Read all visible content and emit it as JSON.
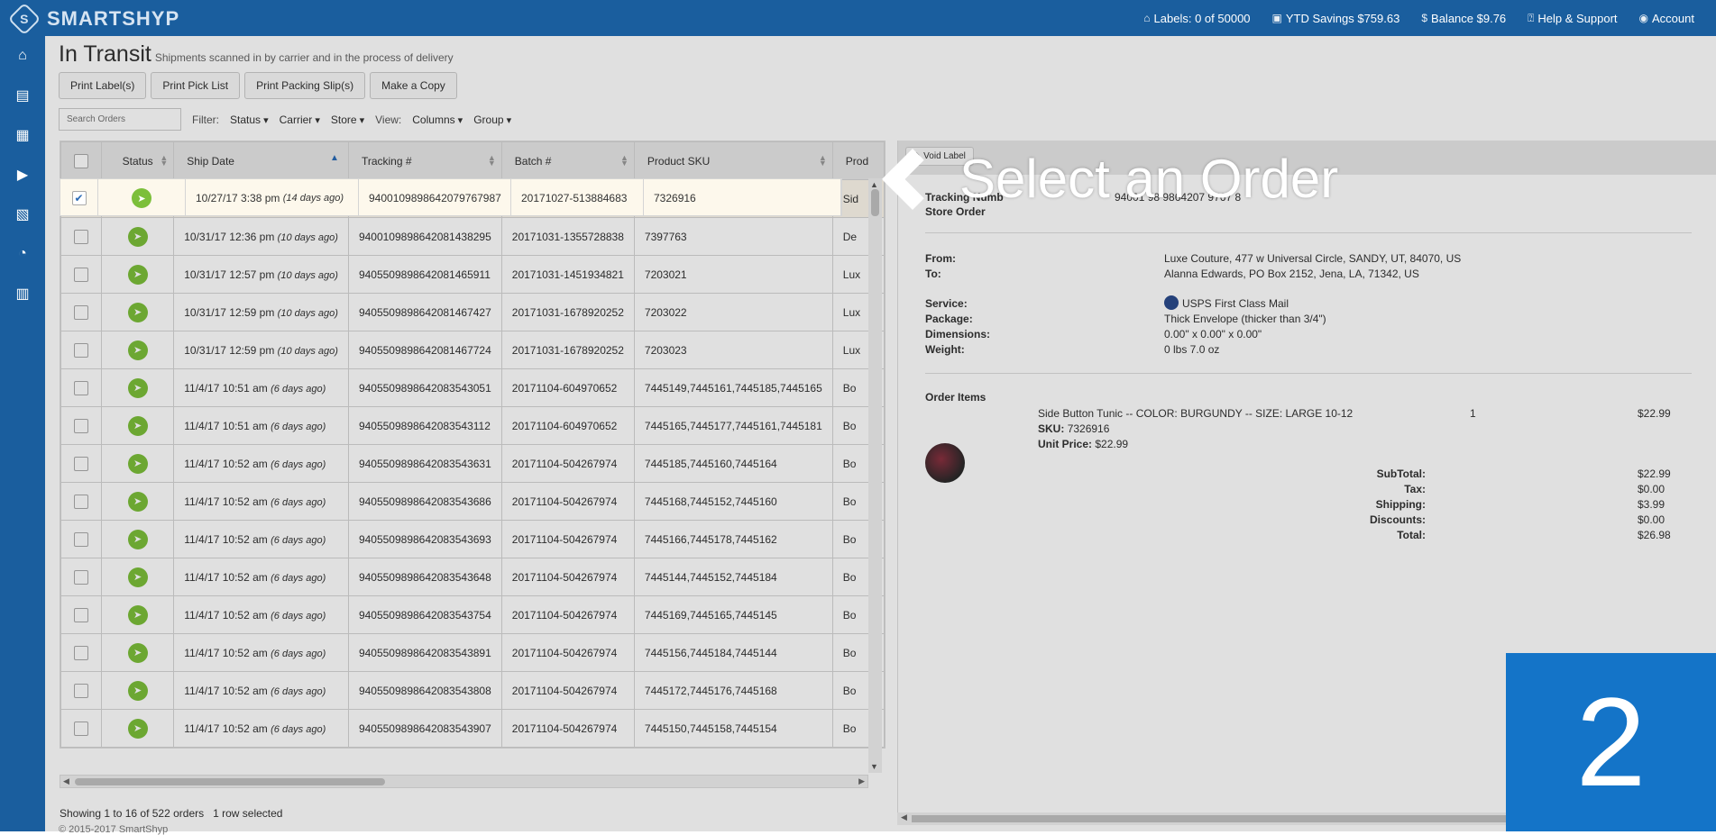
{
  "brand": {
    "logo_letter": "S",
    "name": "SMARTSHYP"
  },
  "topnav": [
    {
      "icon": "tag-icon",
      "glyph": "⌂",
      "label": "Labels: 0 of 50000"
    },
    {
      "icon": "money-icon",
      "glyph": "▣",
      "label": "YTD Savings $759.63"
    },
    {
      "icon": "dollar-icon",
      "glyph": "$",
      "label": "Balance $9.76"
    },
    {
      "icon": "help-icon",
      "glyph": "⍰",
      "label": "Help & Support"
    },
    {
      "icon": "user-icon",
      "glyph": "◉",
      "label": "Account"
    }
  ],
  "sidebar": [
    {
      "icon": "home-icon",
      "glyph": "⌂"
    },
    {
      "icon": "basket-icon",
      "glyph": "▤"
    },
    {
      "icon": "calendar-icon",
      "glyph": "▦"
    },
    {
      "icon": "truck-icon",
      "glyph": "▶"
    },
    {
      "icon": "address-book-icon",
      "glyph": "▧"
    },
    {
      "icon": "pie-chart-icon",
      "glyph": "◔"
    },
    {
      "icon": "cart-icon",
      "glyph": "▥"
    }
  ],
  "page": {
    "title": "In Transit",
    "subtitle": "Shipments scanned in by carrier and in the process of delivery"
  },
  "actions": [
    "Print Label(s)",
    "Print Pick List",
    "Print Packing Slip(s)",
    "Make a Copy"
  ],
  "filters": {
    "search_placeholder": "Search Orders",
    "filter_label": "Filter:",
    "status": "Status",
    "carrier": "Carrier",
    "store": "Store",
    "view_label": "View:",
    "columns": "Columns",
    "group": "Group"
  },
  "columns": [
    "Status",
    "Ship Date",
    "Tracking #",
    "Batch #",
    "Product SKU",
    "Prod"
  ],
  "rows": [
    {
      "checked": true,
      "date": "10/27/17 3:38 pm",
      "ago": "(14 days ago)",
      "tracking": "9400109898642079767987",
      "batch": "20171027-513884683",
      "sku": "7326916",
      "prod": "Sid"
    },
    {
      "checked": false,
      "date": "10/31/17 12:36 pm",
      "ago": "(10 days ago)",
      "tracking": "9400109898642081438295",
      "batch": "20171031-1355728838",
      "sku": "7397763",
      "prod": "De"
    },
    {
      "checked": false,
      "date": "10/31/17 12:57 pm",
      "ago": "(10 days ago)",
      "tracking": "9405509898642081465911",
      "batch": "20171031-1451934821",
      "sku": "7203021",
      "prod": "Lux"
    },
    {
      "checked": false,
      "date": "10/31/17 12:59 pm",
      "ago": "(10 days ago)",
      "tracking": "9405509898642081467427",
      "batch": "20171031-1678920252",
      "sku": "7203022",
      "prod": "Lux"
    },
    {
      "checked": false,
      "date": "10/31/17 12:59 pm",
      "ago": "(10 days ago)",
      "tracking": "9405509898642081467724",
      "batch": "20171031-1678920252",
      "sku": "7203023",
      "prod": "Lux"
    },
    {
      "checked": false,
      "date": "11/4/17 10:51 am",
      "ago": "(6 days ago)",
      "tracking": "9405509898642083543051",
      "batch": "20171104-604970652",
      "sku": "7445149,7445161,7445185,7445165",
      "prod": "Bo"
    },
    {
      "checked": false,
      "date": "11/4/17 10:51 am",
      "ago": "(6 days ago)",
      "tracking": "9405509898642083543112",
      "batch": "20171104-604970652",
      "sku": "7445165,7445177,7445161,7445181",
      "prod": "Bo"
    },
    {
      "checked": false,
      "date": "11/4/17 10:52 am",
      "ago": "(6 days ago)",
      "tracking": "9405509898642083543631",
      "batch": "20171104-504267974",
      "sku": "7445185,7445160,7445164",
      "prod": "Bo"
    },
    {
      "checked": false,
      "date": "11/4/17 10:52 am",
      "ago": "(6 days ago)",
      "tracking": "9405509898642083543686",
      "batch": "20171104-504267974",
      "sku": "7445168,7445152,7445160",
      "prod": "Bo"
    },
    {
      "checked": false,
      "date": "11/4/17 10:52 am",
      "ago": "(6 days ago)",
      "tracking": "9405509898642083543693",
      "batch": "20171104-504267974",
      "sku": "7445166,7445178,7445162",
      "prod": "Bo"
    },
    {
      "checked": false,
      "date": "11/4/17 10:52 am",
      "ago": "(6 days ago)",
      "tracking": "9405509898642083543648",
      "batch": "20171104-504267974",
      "sku": "7445144,7445152,7445184",
      "prod": "Bo"
    },
    {
      "checked": false,
      "date": "11/4/17 10:52 am",
      "ago": "(6 days ago)",
      "tracking": "9405509898642083543754",
      "batch": "20171104-504267974",
      "sku": "7445169,7445165,7445145",
      "prod": "Bo"
    },
    {
      "checked": false,
      "date": "11/4/17 10:52 am",
      "ago": "(6 days ago)",
      "tracking": "9405509898642083543891",
      "batch": "20171104-504267974",
      "sku": "7445156,7445184,7445144",
      "prod": "Bo"
    },
    {
      "checked": false,
      "date": "11/4/17 10:52 am",
      "ago": "(6 days ago)",
      "tracking": "9405509898642083543808",
      "batch": "20171104-504267974",
      "sku": "7445172,7445176,7445168",
      "prod": "Bo"
    },
    {
      "checked": false,
      "date": "11/4/17 10:52 am",
      "ago": "(6 days ago)",
      "tracking": "9405509898642083543907",
      "batch": "20171104-504267974",
      "sku": "7445150,7445158,7445154",
      "prod": "Bo"
    }
  ],
  "status": {
    "showing": "Showing 1 to 16 of 522 orders",
    "selected": "1 row selected"
  },
  "detail": {
    "void_label": "Void Label",
    "tracking_label": "Tracking Numb",
    "store_order_label": "Store Order",
    "tracking_value": "94001 98 9864207 9767 8",
    "from_label": "From:",
    "from": "Luxe Couture, 477 w Universal Circle, SANDY, UT, 84070, US",
    "to_label": "To:",
    "to": "Alanna Edwards, PO Box 2152, Jena, LA, 71342, US",
    "service_label": "Service:",
    "service": "USPS First Class Mail",
    "package_label": "Package:",
    "package": "Thick Envelope (thicker than 3/4\")",
    "dimensions_label": "Dimensions:",
    "dimensions": "0.00\" x 0.00\" x 0.00\"",
    "weight_label": "Weight:",
    "weight": "0 lbs 7.0 oz",
    "items_label": "Order Items",
    "item_name": "Side Button Tunic -- COLOR: BURGUNDY -- SIZE: LARGE 10-12",
    "item_qty": "1",
    "item_price": "$22.99",
    "sku_label": "SKU:",
    "sku": "7326916",
    "unit_label": "Unit Price:",
    "unit": "$22.99",
    "totals": [
      {
        "label": "SubTotal:",
        "value": "$22.99"
      },
      {
        "label": "Tax:",
        "value": "$0.00"
      },
      {
        "label": "Shipping:",
        "value": "$3.99"
      },
      {
        "label": "Discounts:",
        "value": "$0.00"
      },
      {
        "label": "Total:",
        "value": "$26.98"
      }
    ]
  },
  "footer": "© 2015-2017 SmartShyp",
  "callout": "Select an Order",
  "step": "2"
}
